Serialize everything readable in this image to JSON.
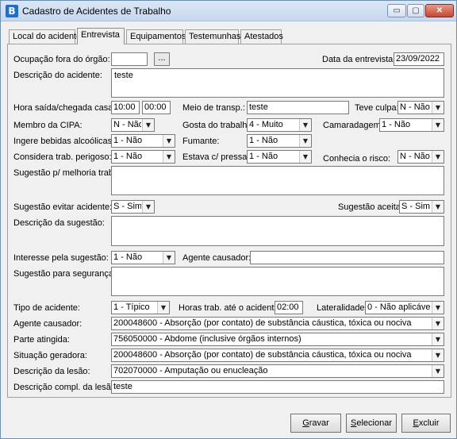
{
  "window": {
    "title": "Cadastro de Acidentes de Trabalho",
    "app_icon_letter": "B",
    "min_glyph": "▭",
    "max_glyph": "▢",
    "close_glyph": "✕"
  },
  "tabs": [
    {
      "label": "Local do acidente"
    },
    {
      "label": "Entrevista",
      "active": true
    },
    {
      "label": "Equipamentos"
    },
    {
      "label": "Testemunhas"
    },
    {
      "label": "Atestados"
    }
  ],
  "form": {
    "ocupacao_label": "Ocupação fora do órgão:",
    "ocupacao_value": "",
    "ellipsis": "...",
    "data_entrevista_label": "Data da entrevista:",
    "data_entrevista_value": "23/09/2022",
    "descricao_acidente_label": "Descrição do acidente:",
    "descricao_acidente_value": "teste",
    "hora_label": "Hora saída/chegada casa:",
    "hora_saida": "10:00",
    "hora_chegada": "00:00",
    "meio_transp_label": "Meio de transp.:",
    "meio_transp_value": "teste",
    "teve_culpa_label": "Teve culpa:",
    "teve_culpa_value": "N - Não",
    "membro_cipa_label": "Membro da CIPA:",
    "membro_cipa_value": "N - Não",
    "gosta_trabalho_label": "Gosta do trabalho:",
    "gosta_trabalho_value": "4 - Muito",
    "camaradagem_label": "Camaradagem:",
    "camaradagem_value": "1 - Não",
    "ingere_bebidas_label": "Ingere bebidas alcoólicas:",
    "ingere_bebidas_value": "1 - Não",
    "fumante_label": "Fumante:",
    "fumante_value": "1 - Não",
    "considera_perigoso_label": "Considera trab. perigoso:",
    "considera_perigoso_value": "1 - Não",
    "estava_pressa_label": "Estava c/ pressa:",
    "estava_pressa_value": "1 - Não",
    "conhecia_risco_label": "Conhecia o risco:",
    "conhecia_risco_value": "N - Não",
    "sugestao_melhoria_label": "Sugestão p/ melhoria trab.:",
    "sugestao_melhoria_value": "",
    "sugestao_evitar_label": "Sugestão evitar acidente:",
    "sugestao_evitar_value": "S - Sim",
    "sugestao_aceita_label": "Sugestão aceita:",
    "sugestao_aceita_value": "S - Sim",
    "descricao_sugestao_label": "Descrição da sugestão:",
    "descricao_sugestao_value": "",
    "interesse_label": "Interesse pela sugestão:",
    "interesse_value": "1 - Não",
    "agente_causador_small_label": "Agente causador:",
    "agente_causador_small_value": "",
    "sugestao_seguranca_label": "Sugestão para segurança:",
    "sugestao_seguranca_value": "",
    "tipo_acidente_label": "Tipo de acidente:",
    "tipo_acidente_value": "1 - Típico",
    "horas_trab_label": "Horas trab. até o acidente:",
    "horas_trab_value": "02:00",
    "lateralidade_label": "Lateralidade:",
    "lateralidade_value": "0 - Não aplicável",
    "agente_causador_label": "Agente causador:",
    "agente_causador_value": "200048600 - Absorção (por contato) de substância cáustica, tóxica ou nociva",
    "parte_atingida_label": "Parte atingida:",
    "parte_atingida_value": "756050000 - Abdome (inclusive órgãos internos)",
    "situacao_geradora_label": "Situação geradora:",
    "situacao_geradora_value": "200048600 - Absorção (por contato) de substância cáustica, tóxica ou nociva",
    "descricao_lesao_label": "Descrição da lesão:",
    "descricao_lesao_value": "702070000 - Amputação ou enucleação",
    "descricao_compl_label": "Descrição compl. da lesão:",
    "descricao_compl_value": "teste",
    "dropdown_glyph": "▼"
  },
  "buttons": {
    "gravar_mnemonic": "G",
    "gravar_rest": "ravar",
    "selecionar_mnemonic": "S",
    "selecionar_rest": "elecionar",
    "excluir_mnemonic": "E",
    "excluir_rest": "xcluir"
  }
}
